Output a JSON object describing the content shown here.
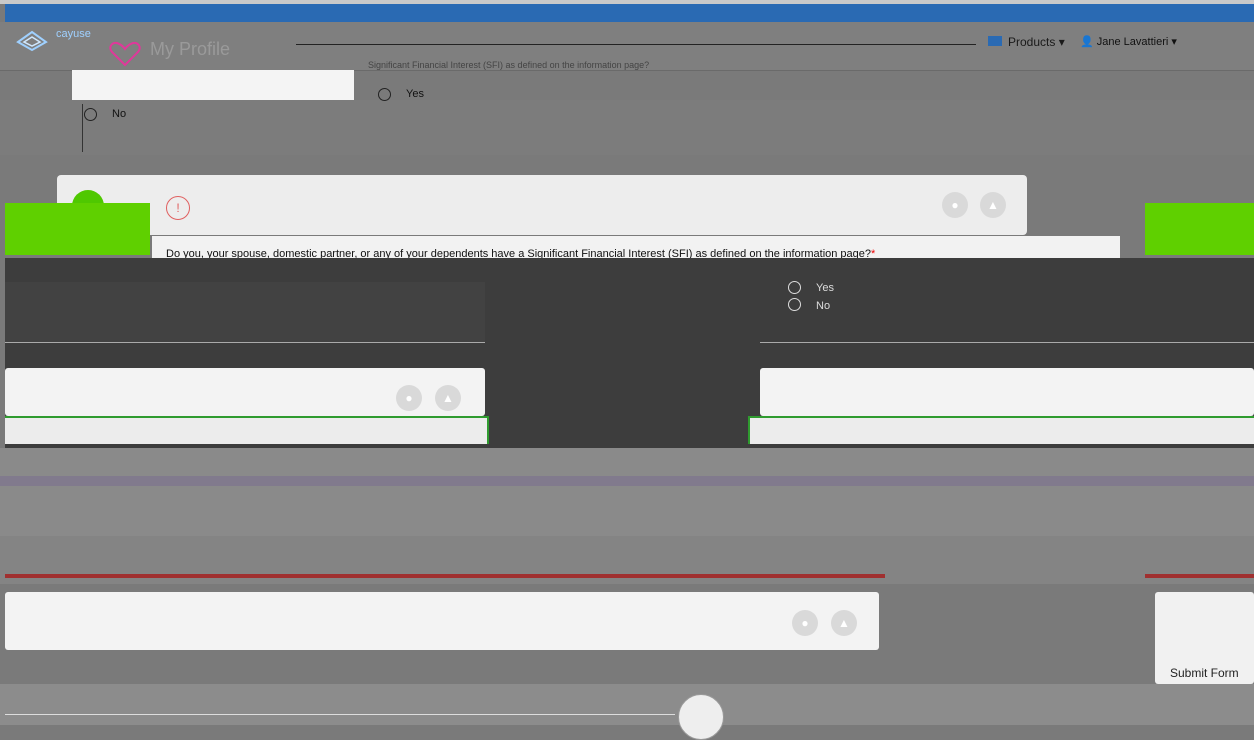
{
  "header": {
    "app_logo_text": "cayuse",
    "page_title": "My Profile",
    "products_label": "Products",
    "user_label": "Jane Lavattieri"
  },
  "previous_question": {
    "text": "Significant Financial Interest (SFI) as defined on the information page?",
    "options": [
      "Yes",
      "No"
    ]
  },
  "question": {
    "text": "Do you, your spouse, domestic partner, or any of your dependents have a Significant Financial Interest (SFI) as defined on the information page?",
    "required_marker": "*",
    "options": [
      "Yes",
      "No"
    ]
  },
  "actions": {
    "submit_label": "Submit Form"
  },
  "icons": {
    "comment": "comment-icon",
    "warning": "warning-icon"
  },
  "colors": {
    "brand_blue": "#2a6ab3",
    "success_green": "#2f9b2f",
    "error_red": "#a03030",
    "status_green": "#4fc800"
  }
}
